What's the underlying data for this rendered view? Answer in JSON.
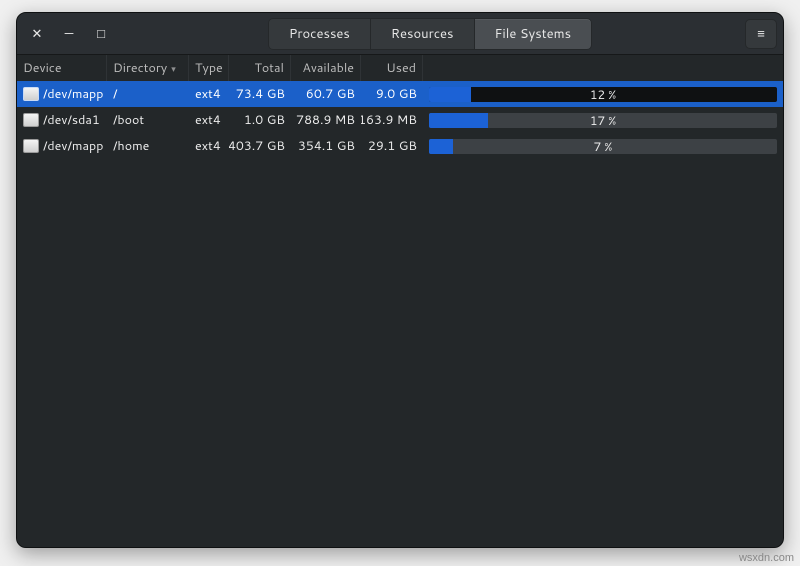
{
  "window": {
    "close_glyph": "✕",
    "minimize_glyph": "—",
    "maximize_glyph": "□",
    "menu_glyph": "≡"
  },
  "tabs": {
    "processes": "Processes",
    "resources": "Resources",
    "filesystems": "File Systems",
    "active": "filesystems"
  },
  "columns": {
    "device": "Device",
    "directory": "Directory",
    "type": "Type",
    "total": "Total",
    "available": "Available",
    "used": "Used",
    "sort_column": "directory",
    "sort_glyph": "▾"
  },
  "rows": [
    {
      "device": "/dev/mapp",
      "directory": "/",
      "type": "ext4",
      "total": "73.4 GB",
      "available": "60.7 GB",
      "used": "9.0 GB",
      "percent": 12,
      "percent_label": "12 %",
      "selected": true
    },
    {
      "device": "/dev/sda1",
      "directory": "/boot",
      "type": "ext4",
      "total": "1.0 GB",
      "available": "788.9 MB",
      "used": "163.9 MB",
      "percent": 17,
      "percent_label": "17 %",
      "selected": false
    },
    {
      "device": "/dev/mapp",
      "directory": "/home",
      "type": "ext4",
      "total": "403.7 GB",
      "available": "354.1 GB",
      "used": "29.1 GB",
      "percent": 7,
      "percent_label": "7 %",
      "selected": false
    }
  ],
  "watermark": "wsxdn.com"
}
